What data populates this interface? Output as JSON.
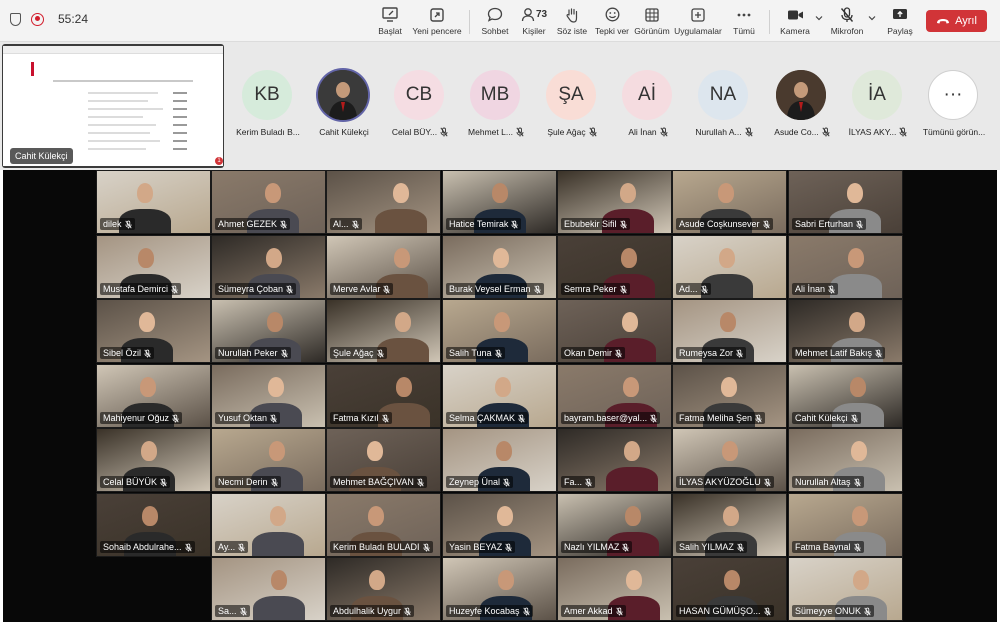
{
  "status": {
    "timer": "55:24"
  },
  "toolbar": {
    "buttons": {
      "start": "Başlat",
      "new_window": "Yeni pencere",
      "chat": "Sohbet",
      "people": "Kişiler",
      "people_count": "73",
      "raise_hand": "Söz iste",
      "react": "Tepki ver",
      "view": "Görünüm",
      "apps": "Uygulamalar",
      "more": "Tümü",
      "camera": "Kamera",
      "mic": "Mikrofon",
      "share": "Paylaş",
      "leave": "Ayrıl"
    }
  },
  "share_preview": {
    "presenter": "Cahit Külekçi",
    "badge": "1"
  },
  "strip": {
    "people": [
      {
        "initials": "KB",
        "name": "Kerim Buladı B...",
        "color": "#d6ebdb",
        "muted": false,
        "photo": false
      },
      {
        "initials": "",
        "name": "Cahit Külekçi",
        "color": "#3a3a3a",
        "muted": false,
        "photo": true
      },
      {
        "initials": "CB",
        "name": "Celal BÜY...",
        "color": "#f5dde3",
        "muted": true,
        "photo": false
      },
      {
        "initials": "MB",
        "name": "Mehmet L...",
        "color": "#f0d6e2",
        "muted": true,
        "photo": false
      },
      {
        "initials": "ŞA",
        "name": "Şule Ağaç",
        "color": "#f9ddd6",
        "muted": true,
        "photo": false
      },
      {
        "initials": "Aİ",
        "name": "Ali İnan",
        "color": "#f5dce0",
        "muted": true,
        "photo": false
      },
      {
        "initials": "NA",
        "name": "Nurullah A...",
        "color": "#dde6ee",
        "muted": true,
        "photo": false
      },
      {
        "initials": "",
        "name": "Asude Co...",
        "color": "#4a3a2e",
        "muted": true,
        "photo": true
      },
      {
        "initials": "İA",
        "name": "İLYAS AKY...",
        "color": "#dfe9da",
        "muted": true,
        "photo": false
      },
      {
        "initials": "",
        "name": "Tümünü görün...",
        "color": "#ffffff",
        "muted": false,
        "photo": false,
        "more": true
      }
    ],
    "more_glyph": "···"
  },
  "gallery": {
    "tiles": [
      [
        "dilek",
        "Ahmet GEZEK",
        "Al...",
        "Hatice Temirak",
        "Ebubekir Sifil",
        "Asude Coşkunsever",
        "Sabri Erturhan"
      ],
      [
        "Mustafa Demirci",
        "Sümeyra Çoban",
        "Merve Avlar",
        "Burak Veysel Erman",
        "Semra Peker",
        "Ad...",
        "Ali İnan"
      ],
      [
        "Sibel Özil",
        "Nurullah Peker",
        "Şule Ağaç",
        "Salih Tuna",
        "Okan Demir",
        "Rumeysa Zor",
        "Mehmet Latif Bakış"
      ],
      [
        "Mahiyenur Oğuz",
        "Yusuf Oktan",
        "Fatma Kızıl",
        "Selma ÇAKMAK",
        "bayram.baser@yal...",
        "Fatma Meliha Şen",
        "Cahit Külekçi"
      ],
      [
        "Celal BÜYÜK",
        "Necmi Derin",
        "Mehmet BAĞÇIVAN",
        "Zeynep Ünal",
        "Fa...",
        "İLYAS AKYÜZOĞLU",
        "Nurullah Altaş"
      ],
      [
        "Sohaib Abdulrahe...",
        "Ay...",
        "Kerim Buladı BULADI",
        "Yasin BEYAZ",
        "Nazlı YILMAZ",
        "Salih YILMAZ",
        "Fatma Baynal"
      ],
      [
        null,
        "Sa...",
        "Abdulhalik Uygur",
        "Huzeyfe Kocabaş",
        "Amer Akkad",
        "HASAN GÜMÜŞO...",
        "Sümeyye ONUK"
      ]
    ]
  },
  "colors": {
    "accent": "#6264a7",
    "leave": "#d13438",
    "gallery_bg": "#080808"
  }
}
